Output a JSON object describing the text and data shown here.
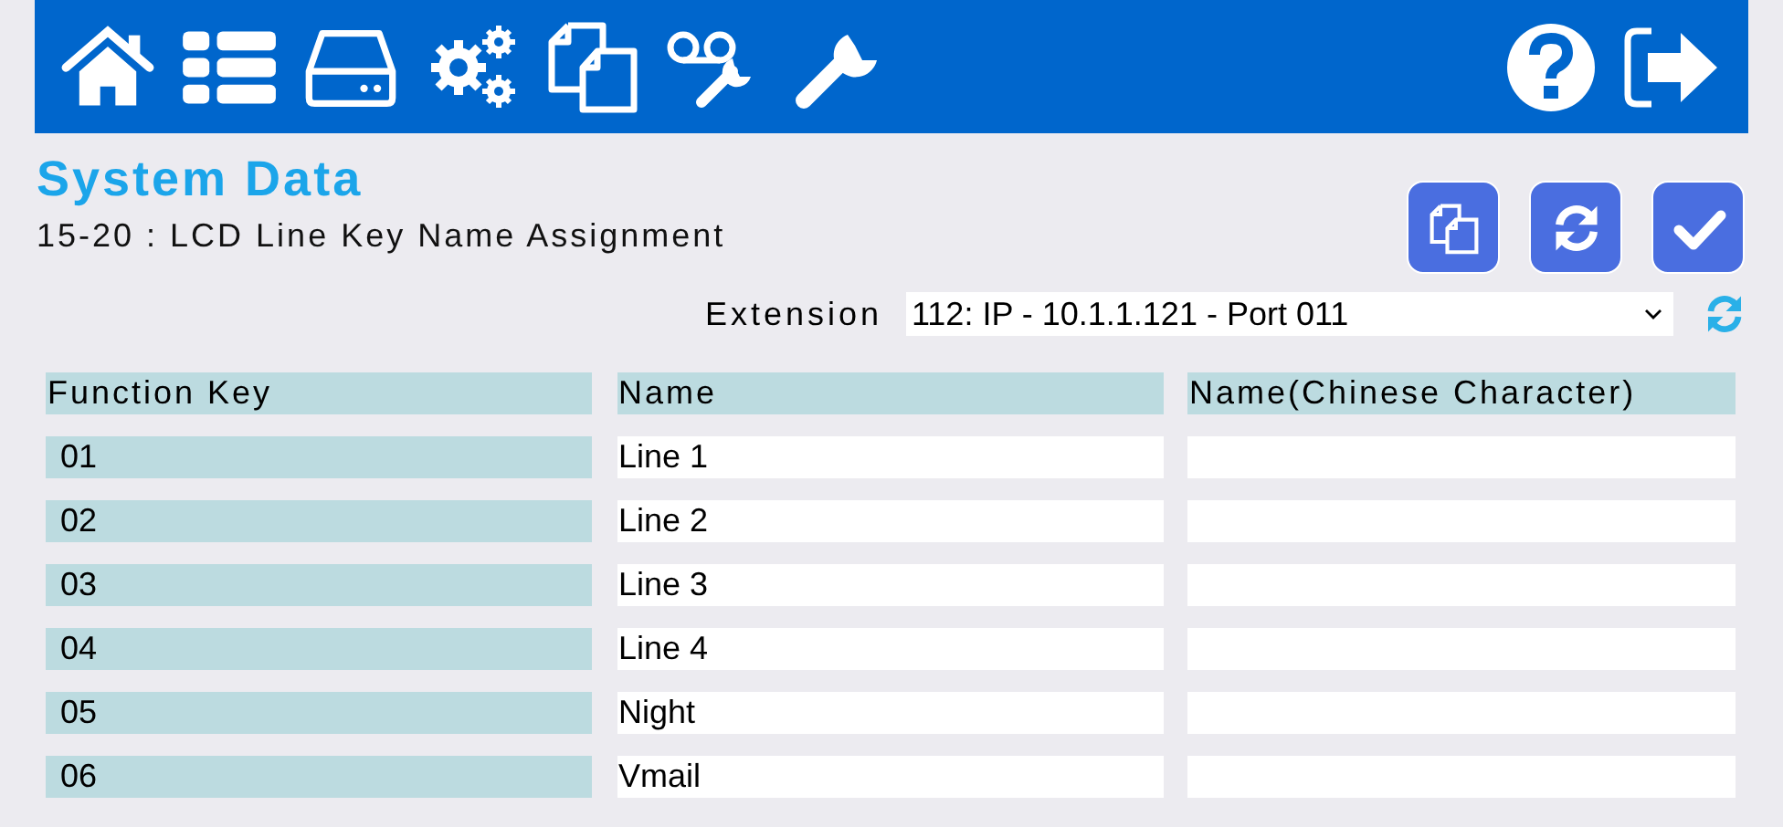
{
  "title": "System Data",
  "subtitle": "15-20 : LCD Line Key Name Assignment",
  "extension": {
    "label": "Extension",
    "value": "112: IP - 10.1.1.121 - Port 011"
  },
  "table": {
    "columns": [
      "Function Key",
      "Name",
      "Name(Chinese Character)"
    ],
    "rows": [
      {
        "key": "01",
        "name": "Line 1"
      },
      {
        "key": "02",
        "name": "Line 2"
      },
      {
        "key": "03",
        "name": "Line 3"
      },
      {
        "key": "04",
        "name": "Line 4"
      },
      {
        "key": "05",
        "name": "Night"
      },
      {
        "key": "06",
        "name": "Vmail"
      }
    ]
  }
}
